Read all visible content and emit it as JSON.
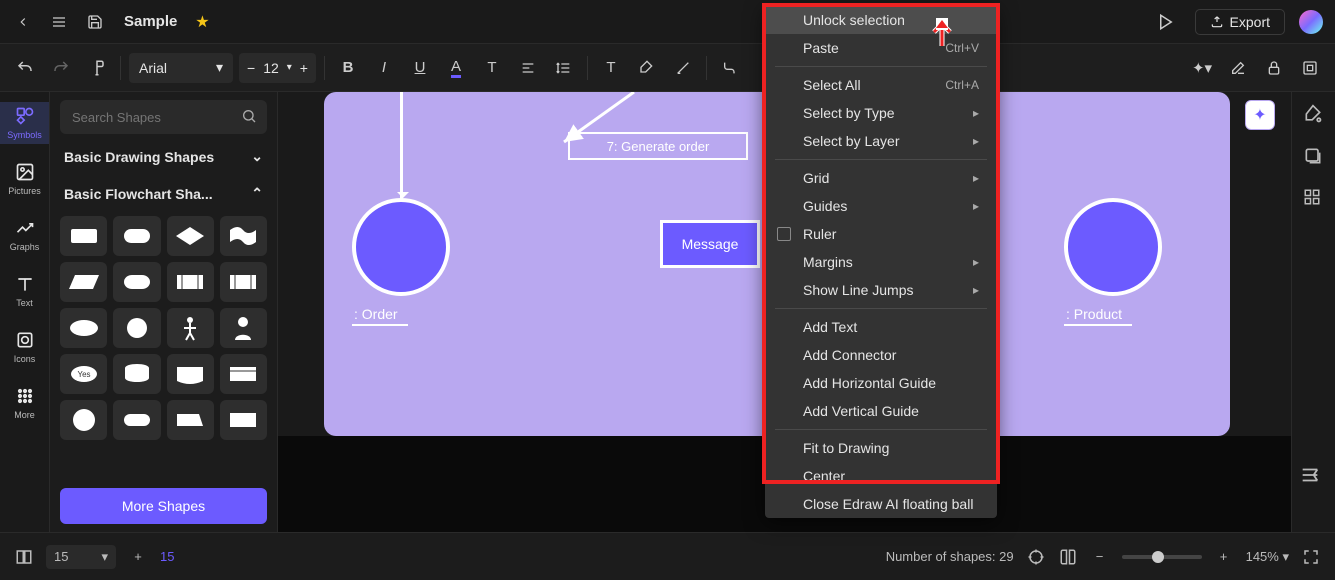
{
  "header": {
    "title": "Sample",
    "export_label": "Export"
  },
  "toolbar": {
    "font": "Arial",
    "font_size": "12"
  },
  "rail": [
    {
      "label": "Symbols",
      "name": "symbols"
    },
    {
      "label": "Pictures",
      "name": "pictures"
    },
    {
      "label": "Graphs",
      "name": "graphs"
    },
    {
      "label": "Text",
      "name": "text"
    },
    {
      "label": "Icons",
      "name": "icons"
    },
    {
      "label": "More",
      "name": "more"
    }
  ],
  "panel": {
    "search_placeholder": "Search Shapes",
    "section_basic": "Basic Drawing Shapes",
    "section_flow": "Basic Flowchart Sha...",
    "more_label": "More Shapes"
  },
  "canvas": {
    "generate_label": "7: Generate order",
    "message_label": "Message",
    "order_label": ": Order",
    "product_label": ": Product"
  },
  "context_menu": {
    "items": [
      {
        "label": "Unlock selection",
        "active": true
      },
      {
        "label": "Paste",
        "shortcut": "Ctrl+V",
        "submenu": true
      },
      {
        "sep": true
      },
      {
        "label": "Select All",
        "shortcut": "Ctrl+A"
      },
      {
        "label": "Select by Type",
        "submenu": true
      },
      {
        "label": "Select by Layer",
        "submenu": true
      },
      {
        "sep": true
      },
      {
        "label": "Grid",
        "submenu": true
      },
      {
        "label": "Guides",
        "submenu": true
      },
      {
        "label": "Ruler",
        "check": true
      },
      {
        "label": "Margins",
        "submenu": true
      },
      {
        "label": "Show Line Jumps",
        "submenu": true
      },
      {
        "sep": true
      },
      {
        "label": "Add Text"
      },
      {
        "label": "Add Connector"
      },
      {
        "label": "Add Horizontal Guide"
      },
      {
        "label": "Add Vertical Guide"
      },
      {
        "sep": true
      },
      {
        "label": "Fit to Drawing"
      },
      {
        "label": "Center",
        "outside_box": true
      },
      {
        "label": "Close Edraw AI floating ball",
        "outside_box": true
      }
    ]
  },
  "status": {
    "page_select": "15",
    "page_link": "15",
    "shapes_label": "Number of shapes: 29",
    "zoom_label": "145%"
  }
}
